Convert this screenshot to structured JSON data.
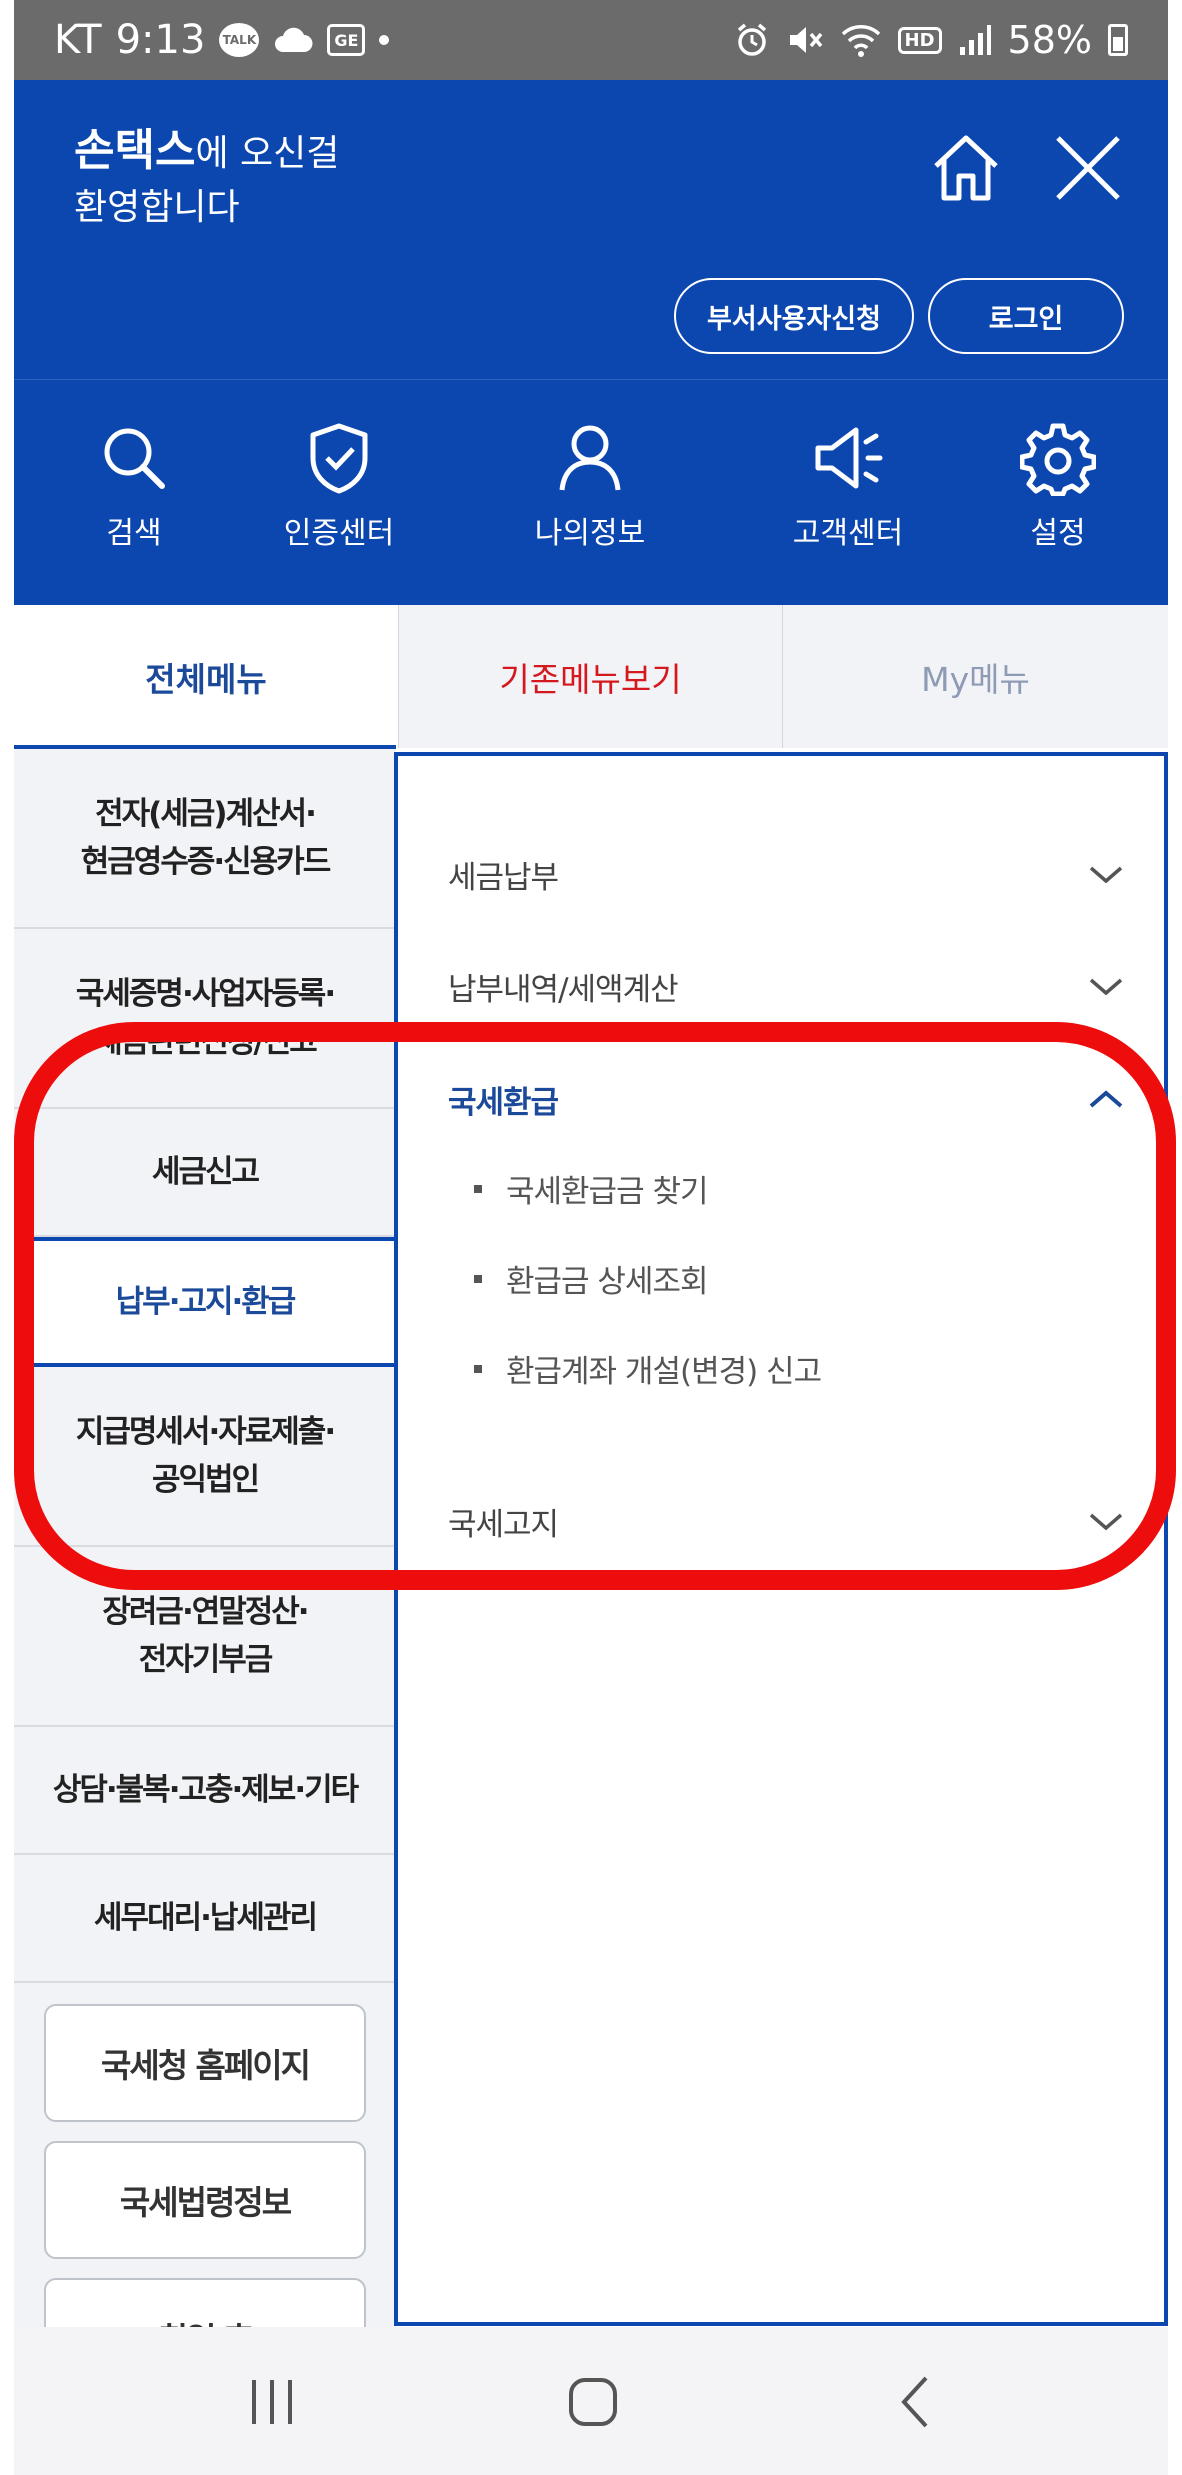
{
  "status_bar": {
    "carrier": "KT",
    "time": "9:13",
    "talk_badge": "TALK",
    "ge_badge": "GE",
    "hd_badge": "HD",
    "battery": "58%"
  },
  "header": {
    "brand": "손택스",
    "welcome_rest": "에 오신걸",
    "welcome_line2": "환영합니다",
    "buttons": {
      "dept_user": "부서사용자신청",
      "login": "로그인"
    }
  },
  "quick_menu": [
    {
      "label": "검색",
      "icon": "search-icon"
    },
    {
      "label": "인증센터",
      "icon": "shield-check-icon"
    },
    {
      "label": "나의정보",
      "icon": "person-icon"
    },
    {
      "label": "고객센터",
      "icon": "megaphone-icon"
    },
    {
      "label": "설정",
      "icon": "gear-icon"
    }
  ],
  "tabs": {
    "all": "전체메뉴",
    "old": "기존메뉴보기",
    "my": "My메뉴"
  },
  "left_menu": [
    {
      "line1": "전자(세금)계산서·",
      "line2": "현금영수증·신용카드"
    },
    {
      "line1": "국세증명·사업자등록·",
      "line2": "세금관련신청/신고"
    },
    {
      "line1": "세금신고",
      "line2": ""
    },
    {
      "line1": "납부·고지·환급",
      "line2": ""
    },
    {
      "line1": "지급명세서·자료제출·",
      "line2": "공익법인"
    },
    {
      "line1": "장려금·연말정산·",
      "line2": "전자기부금"
    },
    {
      "line1": "상담·불복·고충·제보·기타",
      "line2": ""
    },
    {
      "line1": "세무대리·납세관리",
      "line2": ""
    }
  ],
  "left_buttons": [
    "국세청 홈페이지",
    "국세법령정보",
    "취업 후"
  ],
  "right_panel": {
    "items": [
      {
        "label": "세금납부",
        "state": "collapsed"
      },
      {
        "label": "납부내역/세액계산",
        "state": "collapsed"
      },
      {
        "label": "국세환급",
        "state": "expanded"
      },
      {
        "label": "국세고지",
        "state": "collapsed"
      }
    ],
    "sub_items": [
      "국세환급금 찾기",
      "환급금 상세조회",
      "환급계좌 개설(변경) 신고"
    ]
  },
  "colors": {
    "brand_blue": "#0c47b0",
    "highlight_red": "#ee0d0d",
    "old_menu_red": "#d4181e"
  }
}
